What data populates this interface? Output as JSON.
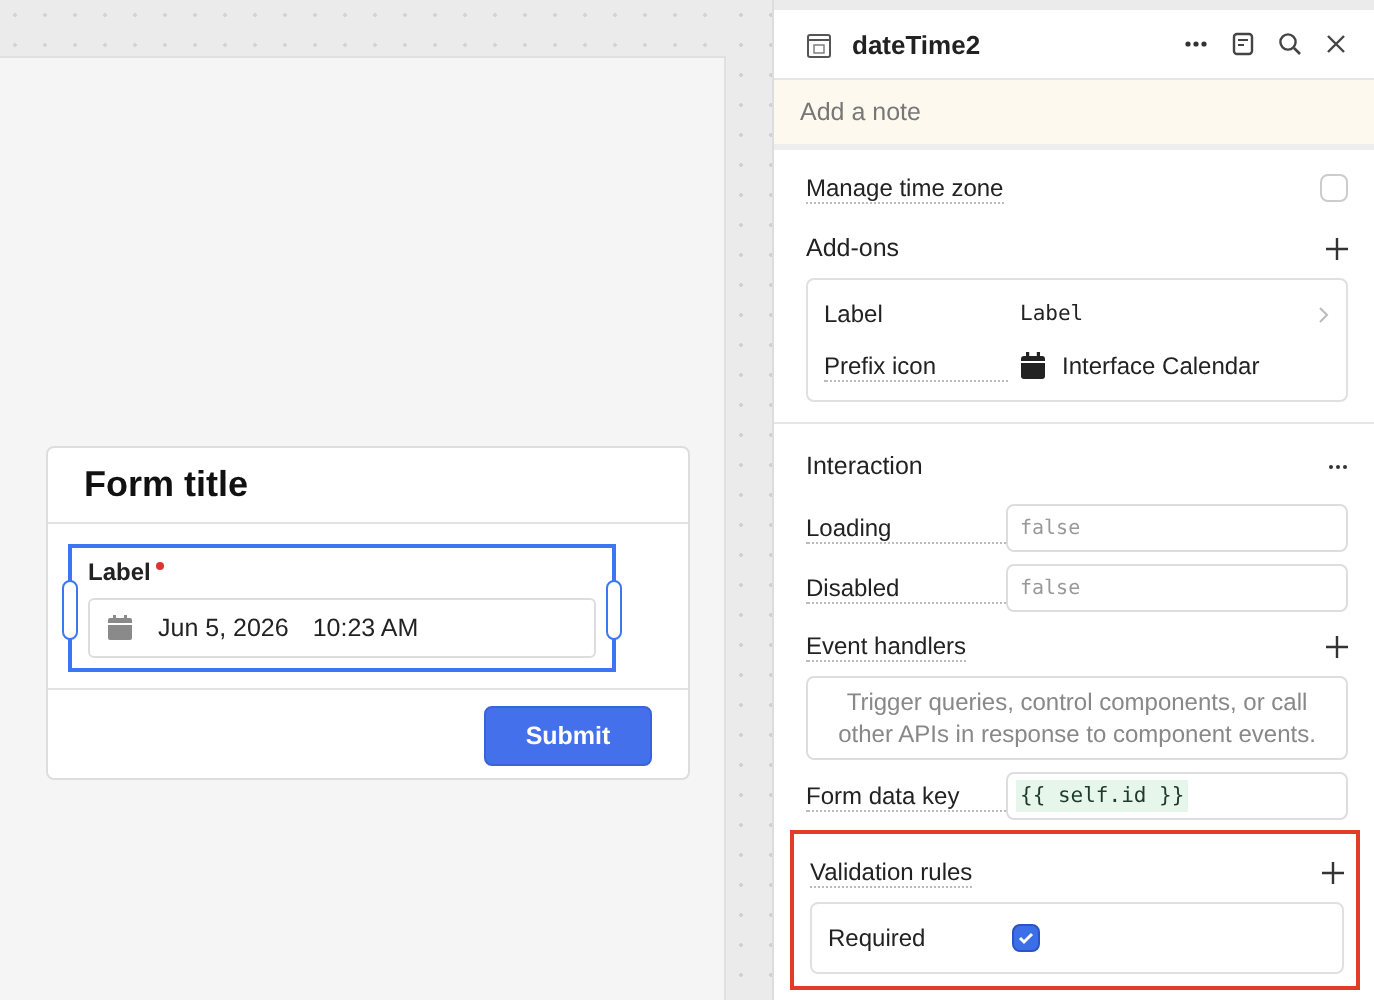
{
  "form": {
    "title": "Form title",
    "field": {
      "label": "Label",
      "required": true,
      "selected": true,
      "date": "Jun 5, 2026",
      "time": "10:23 AM"
    },
    "submit": "Submit"
  },
  "inspector": {
    "title": "dateTime2",
    "note": {
      "placeholder": "Add a note"
    },
    "time_zone": {
      "label": "Manage time zone",
      "checked": false
    },
    "addons": {
      "title": "Add-ons",
      "rows": [
        {
          "kind": "label",
          "label": "Label",
          "value": "Label"
        },
        {
          "kind": "icon",
          "label": "Prefix icon",
          "value": "Interface Calendar"
        }
      ]
    },
    "interaction": {
      "title": "Interaction",
      "loading": {
        "label": "Loading",
        "placeholder": "false"
      },
      "disabled": {
        "label": "Disabled",
        "placeholder": "false"
      },
      "event_handlers": {
        "label": "Event handlers",
        "hint": "Trigger queries, control components, or call other APIs in response to component events."
      },
      "form_data_key": {
        "label": "Form data key",
        "value": "{{ self.id }}"
      }
    },
    "validation": {
      "title": "Validation rules",
      "highlighted": true,
      "required": {
        "label": "Required",
        "checked": true
      }
    }
  }
}
